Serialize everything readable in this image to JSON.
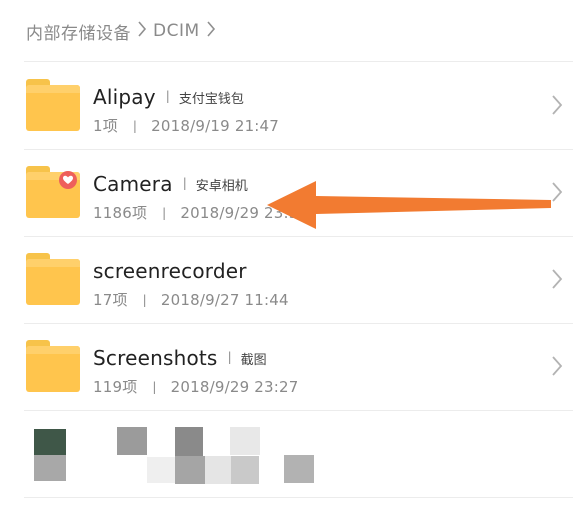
{
  "breadcrumb": {
    "root": "内部存储设备",
    "current": "DCIM"
  },
  "folders": [
    {
      "name": "Alipay",
      "alias": "支付宝钱包",
      "count": "1项",
      "date": "2018/9/19 21:47"
    },
    {
      "name": "Camera",
      "alias": "安卓相机",
      "count": "1186项",
      "date": "2018/9/29 23:30"
    },
    {
      "name": "screenrecorder",
      "alias": "",
      "count": "17项",
      "date": "2018/9/27 11:44"
    },
    {
      "name": "Screenshots",
      "alias": "截图",
      "count": "119项",
      "date": "2018/9/29 23:27"
    }
  ],
  "meta_separator": "|",
  "colors": {
    "folder": "#ffc54d",
    "badge": "#ee5f5b",
    "annotation_arrow": "#f27b31"
  },
  "icons": {
    "folder": "folder-icon",
    "badge": "heart-icon",
    "chevron": "chevron-right-icon",
    "arrow": "arrow-left-icon"
  }
}
